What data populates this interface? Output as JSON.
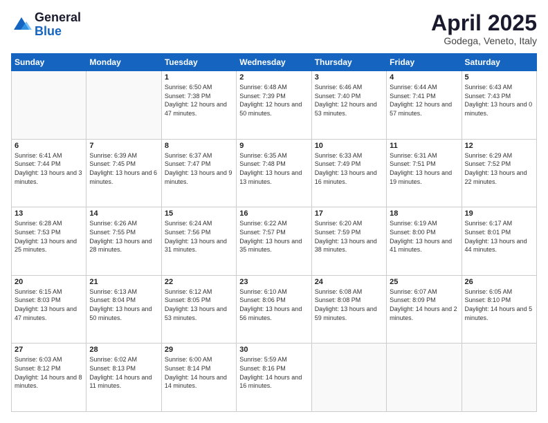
{
  "header": {
    "logo_general": "General",
    "logo_blue": "Blue",
    "month_title": "April 2025",
    "location": "Godega, Veneto, Italy"
  },
  "weekdays": [
    "Sunday",
    "Monday",
    "Tuesday",
    "Wednesday",
    "Thursday",
    "Friday",
    "Saturday"
  ],
  "weeks": [
    [
      {
        "day": "",
        "sunrise": "",
        "sunset": "",
        "daylight": ""
      },
      {
        "day": "",
        "sunrise": "",
        "sunset": "",
        "daylight": ""
      },
      {
        "day": "1",
        "sunrise": "Sunrise: 6:50 AM",
        "sunset": "Sunset: 7:38 PM",
        "daylight": "Daylight: 12 hours and 47 minutes."
      },
      {
        "day": "2",
        "sunrise": "Sunrise: 6:48 AM",
        "sunset": "Sunset: 7:39 PM",
        "daylight": "Daylight: 12 hours and 50 minutes."
      },
      {
        "day": "3",
        "sunrise": "Sunrise: 6:46 AM",
        "sunset": "Sunset: 7:40 PM",
        "daylight": "Daylight: 12 hours and 53 minutes."
      },
      {
        "day": "4",
        "sunrise": "Sunrise: 6:44 AM",
        "sunset": "Sunset: 7:41 PM",
        "daylight": "Daylight: 12 hours and 57 minutes."
      },
      {
        "day": "5",
        "sunrise": "Sunrise: 6:43 AM",
        "sunset": "Sunset: 7:43 PM",
        "daylight": "Daylight: 13 hours and 0 minutes."
      }
    ],
    [
      {
        "day": "6",
        "sunrise": "Sunrise: 6:41 AM",
        "sunset": "Sunset: 7:44 PM",
        "daylight": "Daylight: 13 hours and 3 minutes."
      },
      {
        "day": "7",
        "sunrise": "Sunrise: 6:39 AM",
        "sunset": "Sunset: 7:45 PM",
        "daylight": "Daylight: 13 hours and 6 minutes."
      },
      {
        "day": "8",
        "sunrise": "Sunrise: 6:37 AM",
        "sunset": "Sunset: 7:47 PM",
        "daylight": "Daylight: 13 hours and 9 minutes."
      },
      {
        "day": "9",
        "sunrise": "Sunrise: 6:35 AM",
        "sunset": "Sunset: 7:48 PM",
        "daylight": "Daylight: 13 hours and 13 minutes."
      },
      {
        "day": "10",
        "sunrise": "Sunrise: 6:33 AM",
        "sunset": "Sunset: 7:49 PM",
        "daylight": "Daylight: 13 hours and 16 minutes."
      },
      {
        "day": "11",
        "sunrise": "Sunrise: 6:31 AM",
        "sunset": "Sunset: 7:51 PM",
        "daylight": "Daylight: 13 hours and 19 minutes."
      },
      {
        "day": "12",
        "sunrise": "Sunrise: 6:29 AM",
        "sunset": "Sunset: 7:52 PM",
        "daylight": "Daylight: 13 hours and 22 minutes."
      }
    ],
    [
      {
        "day": "13",
        "sunrise": "Sunrise: 6:28 AM",
        "sunset": "Sunset: 7:53 PM",
        "daylight": "Daylight: 13 hours and 25 minutes."
      },
      {
        "day": "14",
        "sunrise": "Sunrise: 6:26 AM",
        "sunset": "Sunset: 7:55 PM",
        "daylight": "Daylight: 13 hours and 28 minutes."
      },
      {
        "day": "15",
        "sunrise": "Sunrise: 6:24 AM",
        "sunset": "Sunset: 7:56 PM",
        "daylight": "Daylight: 13 hours and 31 minutes."
      },
      {
        "day": "16",
        "sunrise": "Sunrise: 6:22 AM",
        "sunset": "Sunset: 7:57 PM",
        "daylight": "Daylight: 13 hours and 35 minutes."
      },
      {
        "day": "17",
        "sunrise": "Sunrise: 6:20 AM",
        "sunset": "Sunset: 7:59 PM",
        "daylight": "Daylight: 13 hours and 38 minutes."
      },
      {
        "day": "18",
        "sunrise": "Sunrise: 6:19 AM",
        "sunset": "Sunset: 8:00 PM",
        "daylight": "Daylight: 13 hours and 41 minutes."
      },
      {
        "day": "19",
        "sunrise": "Sunrise: 6:17 AM",
        "sunset": "Sunset: 8:01 PM",
        "daylight": "Daylight: 13 hours and 44 minutes."
      }
    ],
    [
      {
        "day": "20",
        "sunrise": "Sunrise: 6:15 AM",
        "sunset": "Sunset: 8:03 PM",
        "daylight": "Daylight: 13 hours and 47 minutes."
      },
      {
        "day": "21",
        "sunrise": "Sunrise: 6:13 AM",
        "sunset": "Sunset: 8:04 PM",
        "daylight": "Daylight: 13 hours and 50 minutes."
      },
      {
        "day": "22",
        "sunrise": "Sunrise: 6:12 AM",
        "sunset": "Sunset: 8:05 PM",
        "daylight": "Daylight: 13 hours and 53 minutes."
      },
      {
        "day": "23",
        "sunrise": "Sunrise: 6:10 AM",
        "sunset": "Sunset: 8:06 PM",
        "daylight": "Daylight: 13 hours and 56 minutes."
      },
      {
        "day": "24",
        "sunrise": "Sunrise: 6:08 AM",
        "sunset": "Sunset: 8:08 PM",
        "daylight": "Daylight: 13 hours and 59 minutes."
      },
      {
        "day": "25",
        "sunrise": "Sunrise: 6:07 AM",
        "sunset": "Sunset: 8:09 PM",
        "daylight": "Daylight: 14 hours and 2 minutes."
      },
      {
        "day": "26",
        "sunrise": "Sunrise: 6:05 AM",
        "sunset": "Sunset: 8:10 PM",
        "daylight": "Daylight: 14 hours and 5 minutes."
      }
    ],
    [
      {
        "day": "27",
        "sunrise": "Sunrise: 6:03 AM",
        "sunset": "Sunset: 8:12 PM",
        "daylight": "Daylight: 14 hours and 8 minutes."
      },
      {
        "day": "28",
        "sunrise": "Sunrise: 6:02 AM",
        "sunset": "Sunset: 8:13 PM",
        "daylight": "Daylight: 14 hours and 11 minutes."
      },
      {
        "day": "29",
        "sunrise": "Sunrise: 6:00 AM",
        "sunset": "Sunset: 8:14 PM",
        "daylight": "Daylight: 14 hours and 14 minutes."
      },
      {
        "day": "30",
        "sunrise": "Sunrise: 5:59 AM",
        "sunset": "Sunset: 8:16 PM",
        "daylight": "Daylight: 14 hours and 16 minutes."
      },
      {
        "day": "",
        "sunrise": "",
        "sunset": "",
        "daylight": ""
      },
      {
        "day": "",
        "sunrise": "",
        "sunset": "",
        "daylight": ""
      },
      {
        "day": "",
        "sunrise": "",
        "sunset": "",
        "daylight": ""
      }
    ]
  ]
}
